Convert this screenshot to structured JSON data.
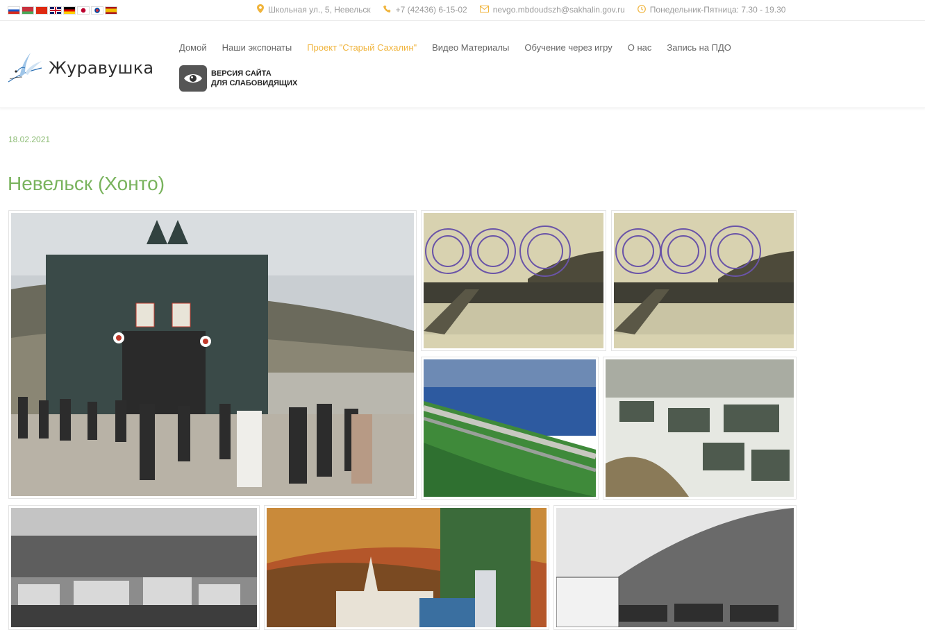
{
  "topbar": {
    "flags": [
      "russia-flag",
      "belarus-flag",
      "china-flag",
      "uk-flag",
      "germany-flag",
      "japan-flag",
      "korea-flag",
      "spain-flag"
    ],
    "address": "Школьная ул., 5, Невельск",
    "phone": "+7 (42436) 6-15-02",
    "email": "nevgo.mbdoudszh@sakhalin.gov.ru",
    "hours": "Понедельник-Пятница: 7.30 - 19.30",
    "icon_color": "#f0b43c"
  },
  "header": {
    "logo_text": "Журавушка",
    "nav": [
      "Домой",
      "Наши экспонаты",
      "Проект \"Старый Сахалин\"",
      "Видео Материалы",
      "Обучение через игру",
      "О нас",
      "Запись на ПДО"
    ],
    "active_nav": "Проект \"Старый Сахалин\"",
    "accessibility_line1": "ВЕРСИЯ САЙТА",
    "accessibility_line2": "ДЛЯ СЛАБОВИДЯЩИХ"
  },
  "post": {
    "date": "18.02.2021",
    "title": "Невельск (Хонто)",
    "accent_color": "#79b35d"
  },
  "gallery": [
    "festival-gate-photo",
    "stamped-postcard-harbor-photo",
    "stamped-postcard-harbor-photo-copy",
    "coastal-aerial-photo",
    "snowy-town-photo",
    "bw-harbor-town-photo",
    "autumn-church-photo",
    "bw-street-trucks-photo"
  ]
}
